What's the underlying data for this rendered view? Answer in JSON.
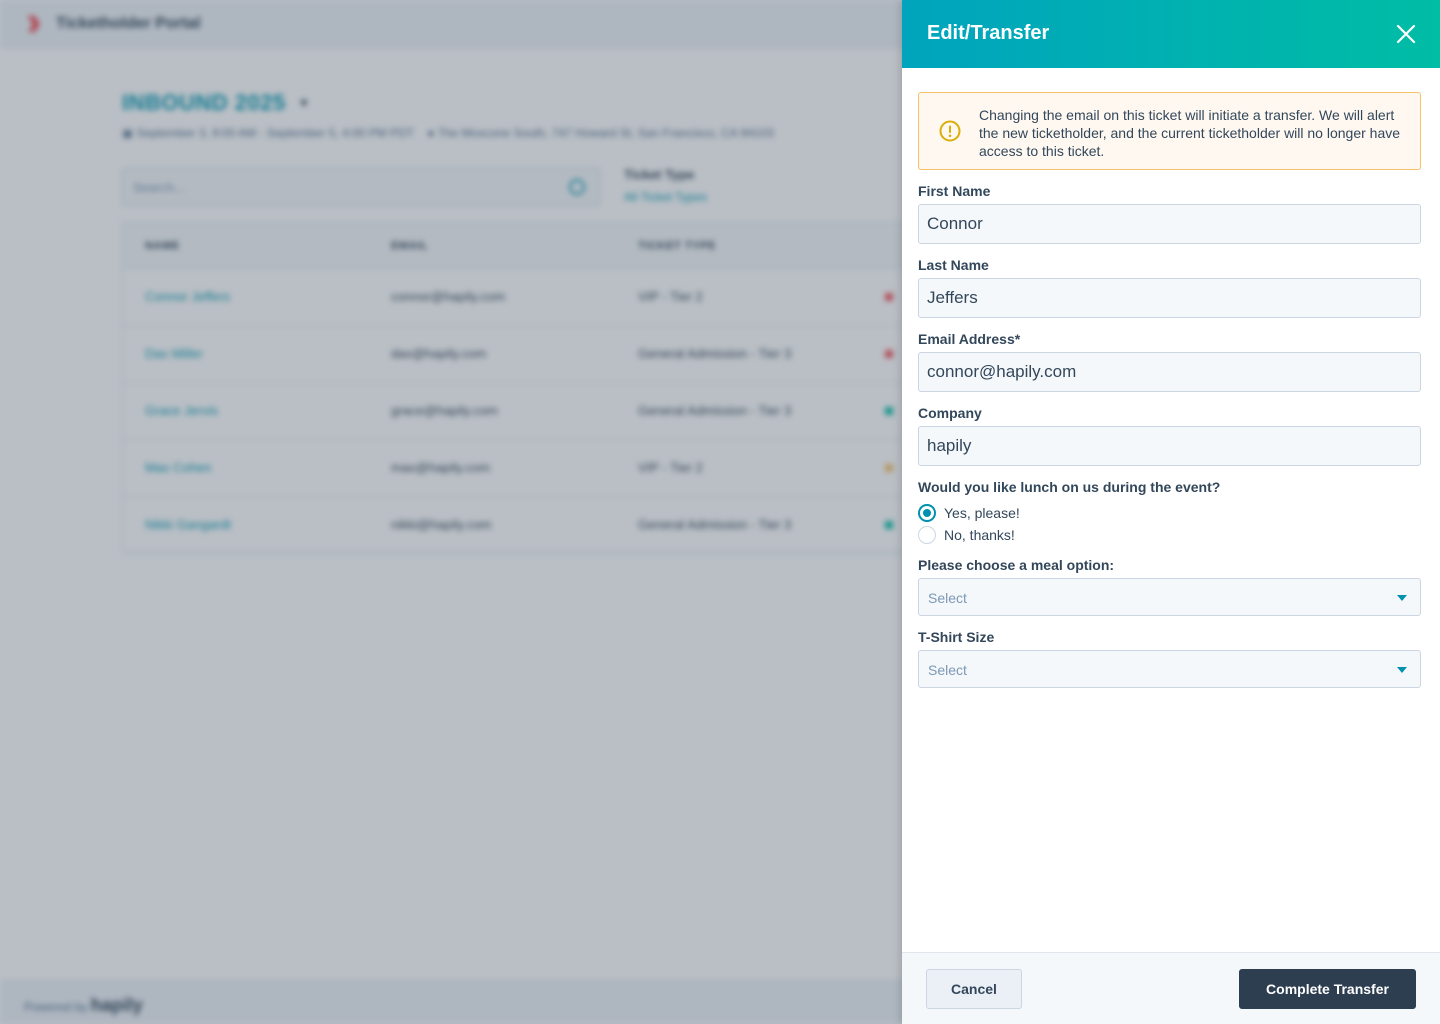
{
  "background": {
    "portal_title": "Ticketholder Portal",
    "event_title": "INBOUND 2025",
    "event_dates": "September 3, 9:00 AM - September 5, 4:00 PM PDT",
    "event_location": "The Moscone South, 747 Howard St, San Francisco, CA 94103",
    "search_placeholder": "Search...",
    "filter_label": "Ticket Type",
    "filter_value": "All Ticket Types",
    "columns": [
      "NAME",
      "EMAIL",
      "TICKET TYPE"
    ],
    "rows": [
      {
        "name": "Connor Jeffers",
        "email": "connor@hapily.com",
        "ticket_type": "VIP - Tier 2",
        "status_color": "#f2545b"
      },
      {
        "name": "Dax Miller",
        "email": "dax@hapily.com",
        "ticket_type": "General Admission - Tier 3",
        "status_color": "#f2545b"
      },
      {
        "name": "Grace Jervis",
        "email": "grace@hapily.com",
        "ticket_type": "General Admission - Tier 3",
        "status_color": "#00bda5"
      },
      {
        "name": "Max Cohen",
        "email": "max@hapily.com",
        "ticket_type": "VIP - Tier 2",
        "status_color": "#f5c26b"
      },
      {
        "name": "Nikki Gangardt",
        "email": "nikki@hapily.com",
        "ticket_type": "General Admission - Tier 3",
        "status_color": "#00bda5"
      }
    ],
    "powered_by": "Powered by",
    "powered_brand": "hapily"
  },
  "panel": {
    "title": "Edit/Transfer",
    "alert_text": "Changing the email on this ticket will initiate a transfer. We will alert the new ticketholder, and the current ticketholder will no longer have access to this ticket.",
    "first_name": {
      "label": "First Name",
      "value": "Connor"
    },
    "last_name": {
      "label": "Last Name",
      "value": "Jeffers"
    },
    "email": {
      "label": "Email Address*",
      "value": "connor@hapily.com"
    },
    "company": {
      "label": "Company",
      "value": "hapily"
    },
    "lunch": {
      "label": "Would you like lunch on us during the event?",
      "options": [
        {
          "label": "Yes, please!",
          "selected": true
        },
        {
          "label": "No, thanks!",
          "selected": false
        }
      ]
    },
    "meal": {
      "label": "Please choose a meal option:",
      "value": "Select"
    },
    "tshirt": {
      "label": "T-Shirt Size",
      "value": "Select"
    },
    "cancel_label": "Cancel",
    "submit_label": "Complete Transfer"
  },
  "colors": {
    "accent": "#0091ae",
    "header_gradient_start": "#00a4bd",
    "header_gradient_end": "#00bda5",
    "primary_button": "#2d3e50",
    "alert_border": "#f5c26b",
    "alert_icon": "#dbae09"
  },
  "icons": {
    "close": "close-icon",
    "alert": "warning-icon",
    "search": "search-icon",
    "select_caret": "chevron-down-icon"
  }
}
